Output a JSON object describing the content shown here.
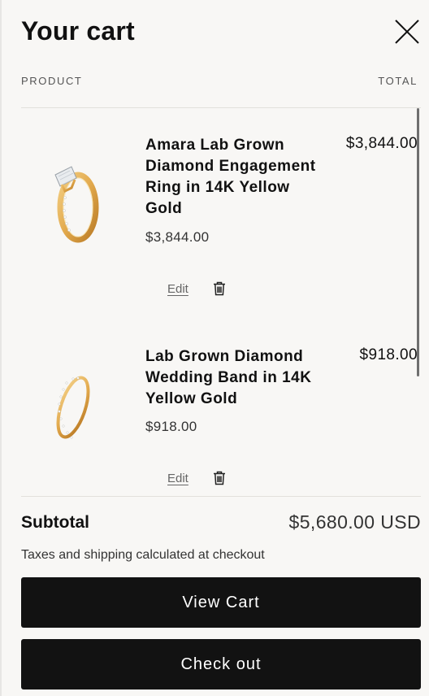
{
  "cart": {
    "title": "Your cart",
    "close_icon": "close-icon",
    "columns": {
      "product": "PRODUCT",
      "total": "TOTAL"
    },
    "items": [
      {
        "name": "Amara Lab Grown Diamond Engagement Ring in 14K Yellow Gold",
        "unit_price": "$3,844.00",
        "line_total": "$3,844.00",
        "edit_label": "Edit",
        "image": "ring-with-oval-diamond-image",
        "remove_icon": "trash-icon"
      },
      {
        "name": "Lab Grown Diamond Wedding Band in 14K Yellow Gold",
        "unit_price": "$918.00",
        "line_total": "$918.00",
        "edit_label": "Edit",
        "image": "pave-wedding-band-image",
        "remove_icon": "trash-icon"
      }
    ],
    "subtotal_label": "Subtotal",
    "subtotal_value": "$5,680.00 USD",
    "tax_note": "Taxes and shipping calculated at checkout",
    "view_cart_label": "View Cart",
    "checkout_label": "Check out"
  },
  "colors": {
    "background": "#f8f7f5",
    "button": "#121212",
    "gold": "#e2a94c"
  }
}
